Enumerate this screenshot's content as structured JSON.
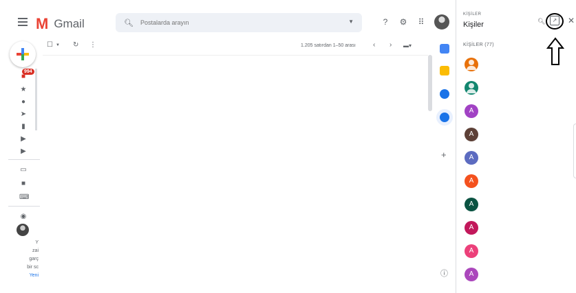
{
  "header": {
    "app_name": "Gmail",
    "search_placeholder": "Postalarda arayın"
  },
  "sidebar": {
    "inbox_badge": "994",
    "hint_lines": [
      "Y",
      "zai",
      "garç",
      "bir sc"
    ],
    "hint_link": "Yeni"
  },
  "toolbar": {
    "pagination": "1.205 satırdan 1–50 arası"
  },
  "contacts_panel": {
    "subtitle": "KİŞİLER",
    "title": "Kişiler",
    "count_label": "KİŞİLER (77)",
    "contacts": [
      {
        "initial": "",
        "color": "#e8710a",
        "type": "person"
      },
      {
        "initial": "",
        "color": "#12866f",
        "type": "person"
      },
      {
        "initial": "A",
        "color": "#a142c4",
        "type": "letter"
      },
      {
        "initial": "A",
        "color": "#5d4037",
        "type": "letter"
      },
      {
        "initial": "A",
        "color": "#5c6bc0",
        "type": "letter"
      },
      {
        "initial": "A",
        "color": "#f4511e",
        "type": "letter"
      },
      {
        "initial": "A",
        "color": "#0b5342",
        "type": "letter"
      },
      {
        "initial": "A",
        "color": "#c2185b",
        "type": "letter"
      },
      {
        "initial": "A",
        "color": "#ec407a",
        "type": "letter"
      },
      {
        "initial": "A",
        "color": "#ab47bc",
        "type": "letter"
      }
    ]
  },
  "colors": {
    "gmail_red": "#ea4335",
    "accent_blue": "#1a73e8"
  }
}
